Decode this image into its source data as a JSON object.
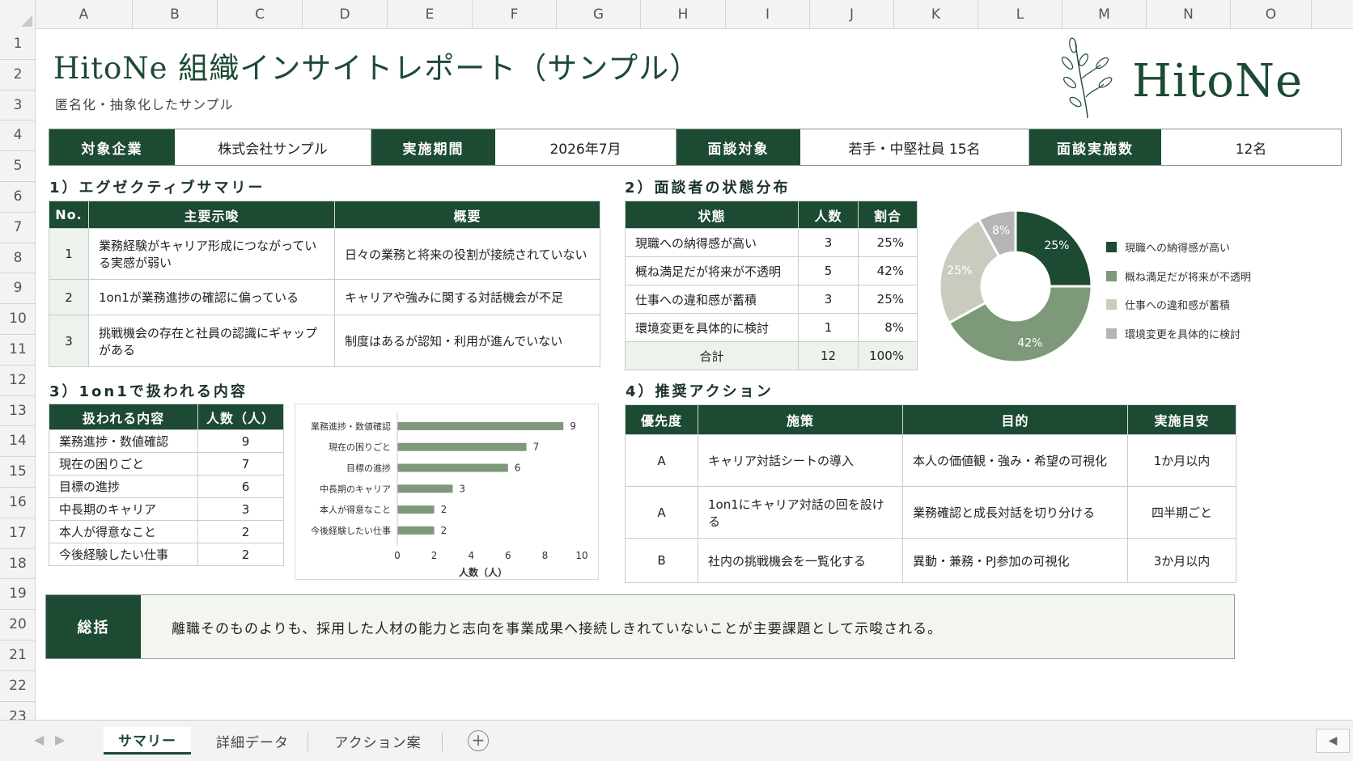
{
  "columns": [
    "A",
    "B",
    "C",
    "D",
    "E",
    "F",
    "G",
    "H",
    "I",
    "J",
    "K",
    "L",
    "M",
    "N",
    "O"
  ],
  "rows": [
    "1",
    "2",
    "3",
    "4",
    "5",
    "6",
    "7",
    "8",
    "9",
    "10",
    "11",
    "12",
    "13",
    "14",
    "15",
    "16",
    "17",
    "18",
    "19",
    "20",
    "21",
    "22",
    "23"
  ],
  "header": {
    "title": "HitoNe 組織インサイトレポート（サンプル）",
    "subtitle": "匿名化・抽象化したサンプル",
    "logo_text": "HitoNe"
  },
  "info_bar": [
    {
      "label": "対象企業",
      "value": "株式会社サンプル"
    },
    {
      "label": "実施期間",
      "value": "2026年7月"
    },
    {
      "label": "面談対象",
      "value": "若手・中堅社員 15名"
    },
    {
      "label": "面談実施数",
      "value": "12名"
    }
  ],
  "section1": {
    "title": "1）エグゼクティブサマリー",
    "headers": [
      "No.",
      "主要示唆",
      "概要"
    ],
    "rows": [
      {
        "no": "1",
        "insight": "業務経験がキャリア形成につながっている実感が弱い",
        "summary": "日々の業務と将来の役割が接続されていない"
      },
      {
        "no": "2",
        "insight": "1on1が業務進捗の確認に偏っている",
        "summary": "キャリアや強みに関する対話機会が不足"
      },
      {
        "no": "3",
        "insight": "挑戦機会の存在と社員の認識にギャップがある",
        "summary": "制度はあるが認知・利用が進んでいない"
      }
    ]
  },
  "section2": {
    "title": "2）面談者の状態分布",
    "headers": [
      "状態",
      "人数",
      "割合"
    ],
    "rows": [
      {
        "state": "現職への納得感が高い",
        "count": "3",
        "ratio": "25%"
      },
      {
        "state": "概ね満足だが将来が不透明",
        "count": "5",
        "ratio": "42%"
      },
      {
        "state": "仕事への違和感が蓄積",
        "count": "3",
        "ratio": "25%"
      },
      {
        "state": "環境変更を具体的に検討",
        "count": "1",
        "ratio": "8%"
      }
    ],
    "total": {
      "label": "合計",
      "count": "12",
      "ratio": "100%"
    }
  },
  "section3": {
    "title": "3）1on1で扱われる内容",
    "headers": [
      "扱われる内容",
      "人数（人）"
    ],
    "rows": [
      {
        "topic": "業務進捗・数値確認",
        "count": "9"
      },
      {
        "topic": "現在の困りごと",
        "count": "7"
      },
      {
        "topic": "目標の進捗",
        "count": "6"
      },
      {
        "topic": "中長期のキャリア",
        "count": "3"
      },
      {
        "topic": "本人が得意なこと",
        "count": "2"
      },
      {
        "topic": "今後経験したい仕事",
        "count": "2"
      }
    ]
  },
  "section4": {
    "title": "4）推奨アクション",
    "headers": [
      "優先度",
      "施策",
      "目的",
      "実施目安"
    ],
    "rows": [
      {
        "priority": "A",
        "measure": "キャリア対話シートの導入",
        "purpose": "本人の価値観・強み・希望の可視化",
        "timing": "1か月以内"
      },
      {
        "priority": "A",
        "measure": "1on1にキャリア対話の回を設ける",
        "purpose": "業務確認と成長対話を切り分ける",
        "timing": "四半期ごと"
      },
      {
        "priority": "B",
        "measure": "社内の挑戦機会を一覧化する",
        "purpose": "異動・兼務・PJ参加の可視化",
        "timing": "3か月以内"
      }
    ]
  },
  "summary": {
    "label": "総括",
    "text": "離職そのものよりも、採用した人材の能力と志向を事業成果へ接続しきれていないことが主要課題として示唆される。"
  },
  "chart_data": [
    {
      "type": "bar",
      "orientation": "horizontal",
      "categories": [
        "業務進捗・数値確認",
        "現在の困りごと",
        "目標の進捗",
        "中長期のキャリア",
        "本人が得意なこと",
        "今後経験したい仕事"
      ],
      "values": [
        9,
        7,
        6,
        3,
        2,
        2
      ],
      "xlabel": "人数（人）",
      "xlim": [
        0,
        10
      ],
      "xticks": [
        "0",
        "2",
        "4",
        "6",
        "8",
        "10"
      ],
      "bar_color": "#7e987a",
      "data_labels": true,
      "grid": false
    },
    {
      "type": "pie",
      "donut": true,
      "categories": [
        "現職への納得感が高い",
        "概ね満足だが将来が不透明",
        "仕事への違和感が蓄積",
        "環境変更を具体的に検討"
      ],
      "values": [
        25,
        42,
        25,
        8
      ],
      "labels": [
        "25%",
        "42%",
        "25%",
        "8%"
      ],
      "colors": [
        "#1d4a33",
        "#7e987a",
        "#c8cbbd",
        "#b5b5b5"
      ],
      "legend": "right"
    }
  ],
  "tabs": [
    {
      "label": "サマリー",
      "active": true
    },
    {
      "label": "詳細データ",
      "active": false
    },
    {
      "label": "アクション案",
      "active": false
    }
  ],
  "tabbar_icons": {
    "prev": "◀",
    "next": "▶",
    "add": "+",
    "scroll": "◀"
  },
  "colors": {
    "accent": "#1d4a33",
    "accent_light": "#7e987a",
    "tint": "#eef2ec"
  }
}
